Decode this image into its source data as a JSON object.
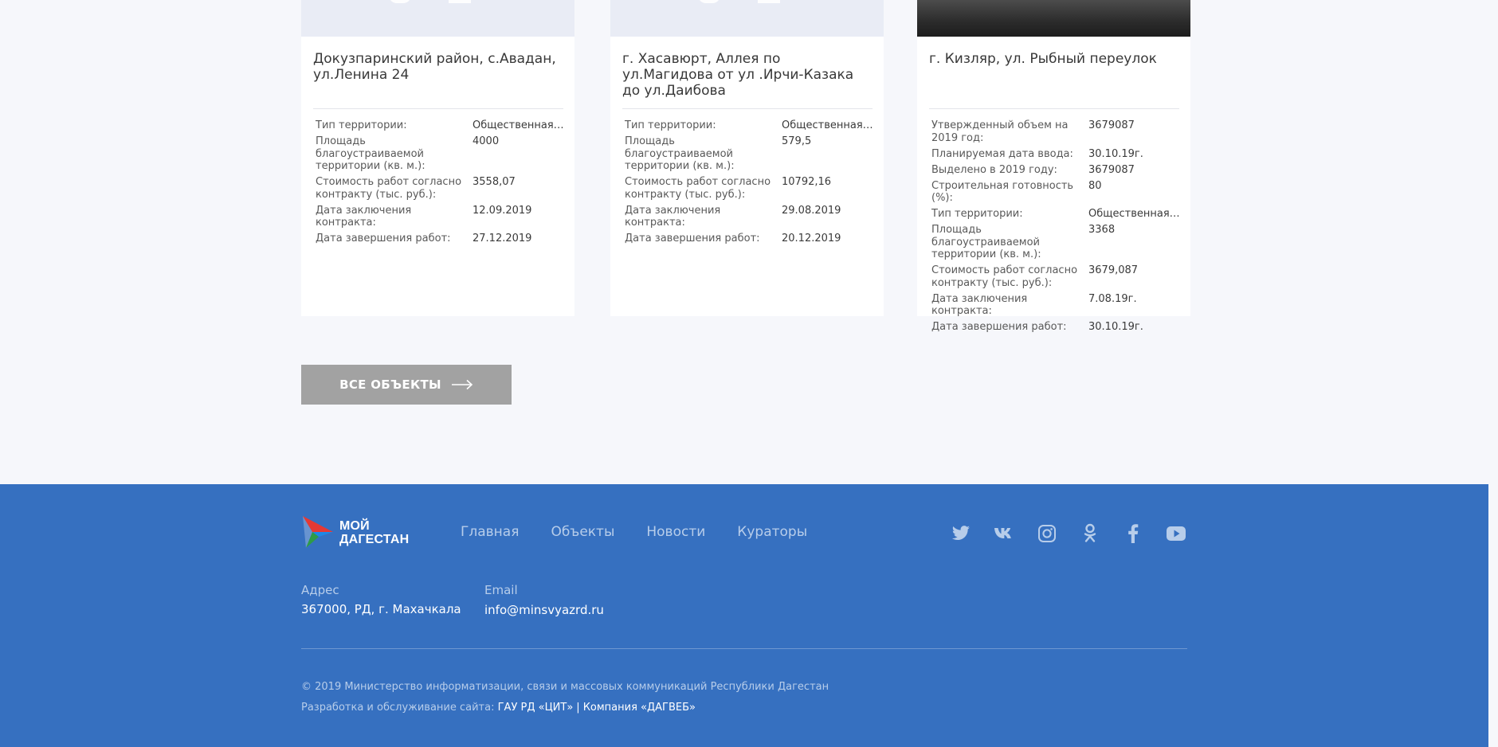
{
  "cards": [
    {
      "title": "Докузпаринский район, с.Авадан, ул.Ленина 24",
      "rows": [
        {
          "label": "Тип территории:",
          "value": "Общественная территория"
        },
        {
          "label": "Площадь благоустраиваемой территории (кв. м.):",
          "value": "4000"
        },
        {
          "label": "Стоимость работ согласно контракту (тыс. руб.):",
          "value": "3558,07"
        },
        {
          "label": "Дата заключения контракта:",
          "value": "12.09.2019"
        },
        {
          "label": "Дата завершения работ:",
          "value": "27.12.2019"
        }
      ]
    },
    {
      "title": "г. Хасавюрт, Аллея по ул.Магидова от ул .Ирчи-Казака до ул.Даибова",
      "rows": [
        {
          "label": "Тип территории:",
          "value": "Общественная территория"
        },
        {
          "label": "Площадь благоустраиваемой территории (кв. м.):",
          "value": "579,5"
        },
        {
          "label": "Стоимость работ согласно контракту (тыс. руб.):",
          "value": "10792,16"
        },
        {
          "label": "Дата заключения контракта:",
          "value": "29.08.2019"
        },
        {
          "label": "Дата завершения работ:",
          "value": "20.12.2019"
        }
      ]
    },
    {
      "title": "г. Кизляр, ул. Рыбный переулок",
      "rows": [
        {
          "label": "Утвержденный объем на 2019 год:",
          "value": "3679087"
        },
        {
          "label": "Планируемая дата ввода:",
          "value": "30.10.19г."
        },
        {
          "label": "Выделено в 2019 году:",
          "value": "3679087"
        },
        {
          "label": "Строительная готовность (%):",
          "value": "80"
        },
        {
          "label": "Тип территории:",
          "value": "Общественная территория"
        },
        {
          "label": "Площадь благоустраиваемой территории (кв. м.):",
          "value": "3368"
        },
        {
          "label": "Стоимость работ согласно контракту (тыс. руб.):",
          "value": "3679,087"
        },
        {
          "label": "Дата заключения контракта:",
          "value": "7.08.19г."
        },
        {
          "label": "Дата завершения работ:",
          "value": "30.10.19г."
        }
      ]
    }
  ],
  "all_objects_button": "ВСЕ ОБЪЕКТЫ",
  "footer": {
    "logo_line1": "МОЙ",
    "logo_line2": "ДАГЕСТАН",
    "nav": [
      "Главная",
      "Объекты",
      "Новости",
      "Кураторы"
    ],
    "social_icons": [
      "twitter-icon",
      "vk-icon",
      "instagram-icon",
      "odnoklassniki-icon",
      "facebook-icon",
      "youtube-icon"
    ],
    "address_label": "Адрес",
    "address_value": "367000, РД, г. Махачкала",
    "email_label": "Email",
    "email_value": "info@minsvyazrd.ru",
    "copyright": "© 2019 Министерство информатизации, связи и массовых коммуникаций Республики Дагестан",
    "dev_label": "Разработка и обслуживание сайта:",
    "dev_link1": "ГАУ РД «ЦИТ»",
    "dev_separator": "|",
    "dev_link2": "Компания «ДАГВЕБ»"
  },
  "colors": {
    "page_background": "#f6f7fb",
    "footer_background": "#3670c0",
    "button_background": "#a2a2a2",
    "footer_muted_text": "#b7cdea"
  }
}
